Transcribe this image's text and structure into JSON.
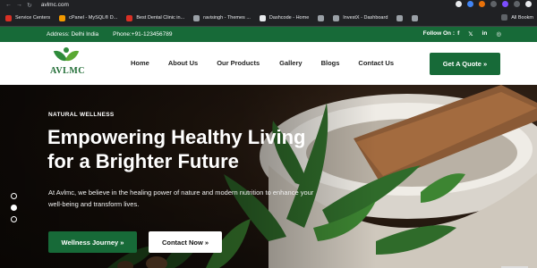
{
  "browser": {
    "url": "avlmc.com",
    "bookmarks": [
      {
        "label": "Service Centers",
        "icon": "youtube-icon"
      },
      {
        "label": "cPanel - MySQL® D...",
        "icon": "cpanel-icon"
      },
      {
        "label": "Best Dental Clinic in...",
        "icon": "dental-icon"
      },
      {
        "label": "ravisingh - Themes ...",
        "icon": "globe-icon"
      },
      {
        "label": "Dashcode - Home",
        "icon": "dashcode-icon"
      },
      {
        "label": "",
        "icon": "globe-icon"
      },
      {
        "label": "InvestX - Dashboard",
        "icon": "globe-icon"
      },
      {
        "label": "",
        "icon": "globe-icon"
      },
      {
        "label": "",
        "icon": "globe-icon"
      }
    ],
    "all_bookmarks": "All Bookm"
  },
  "topbar": {
    "address": "Address: Delhi India",
    "phone": "Phone:+91-123456789",
    "follow_label": "Follow On :",
    "socials": [
      "f",
      "𝕏",
      "in",
      "◎"
    ]
  },
  "brand": {
    "name": "AVLMC"
  },
  "nav": {
    "items": [
      "Home",
      "About Us",
      "Our Products",
      "Gallery",
      "Blogs",
      "Contact Us"
    ],
    "cta": "Get A Quote »"
  },
  "hero": {
    "tagline": "NATURAL WELLNESS",
    "headline_line1": "Empowering Healthy Living",
    "headline_line2": "for a Brighter Future",
    "description": "At Avlmc, we believe in the healing power of nature and modern nutrition to enhance your well-being and transform lives.",
    "primary_button": "Wellness Journey »",
    "secondary_button": "Contact Now »",
    "slides": 3,
    "active_slide": 2
  },
  "colors": {
    "brand_green": "#176a38",
    "hero_dark": "#1a120c"
  }
}
